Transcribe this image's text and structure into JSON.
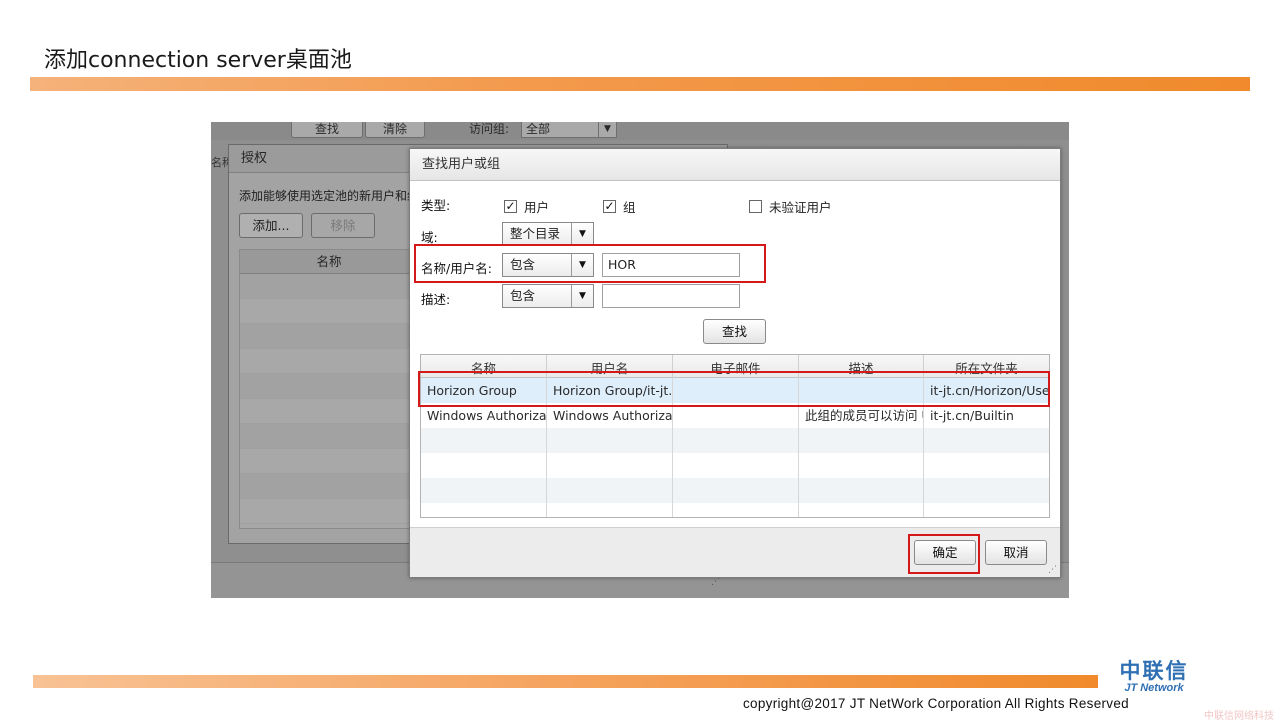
{
  "slide": {
    "title": "添加connection server桌面池",
    "logo_cn": "中联信",
    "logo_en": "JT Network",
    "copyright": "copyright@2017  JT NetWork Corporation All Rights Reserved",
    "watermark": "中联信网络科技",
    "accent_color": "#f08a2c"
  },
  "background_toolbar": {
    "find_label": "查找",
    "clear_label": "清除",
    "access_group_label": "访问组:",
    "access_group_value": "全部",
    "left_column_fragment": "名称"
  },
  "auth_dialog": {
    "title": "授权",
    "description": "添加能够使用选定池的新用户和组",
    "add_label": "添加...",
    "remove_label": "移除",
    "name_header": "名称"
  },
  "find_dialog": {
    "title": "查找用户或组",
    "type_label": "类型:",
    "checkbox_user": "用户",
    "checkbox_group": "组",
    "checkbox_unverified": "未验证用户",
    "domain_label": "域:",
    "domain_value": "整个目录",
    "name_label": "名称/用户名:",
    "name_operator": "包含",
    "name_value": "HOR",
    "desc_label": "描述:",
    "desc_operator": "包含",
    "desc_value": "",
    "search_label": "查找",
    "ok_label": "确定",
    "cancel_label": "取消",
    "columns": [
      "名称",
      "用户名",
      "电子邮件",
      "描述",
      "所在文件夹"
    ],
    "rows": [
      {
        "name": "Horizon Group",
        "username": "Horizon Group/it-jt.",
        "email": "",
        "description": "",
        "folder": "it-jt.cn/Horizon/Use"
      },
      {
        "name": "Windows Authorizat",
        "username": "Windows Authorizat",
        "email": "",
        "description": "此组的成员可以访问 U",
        "folder": "it-jt.cn/Builtin"
      }
    ],
    "highlight_color": "#d4191a"
  }
}
